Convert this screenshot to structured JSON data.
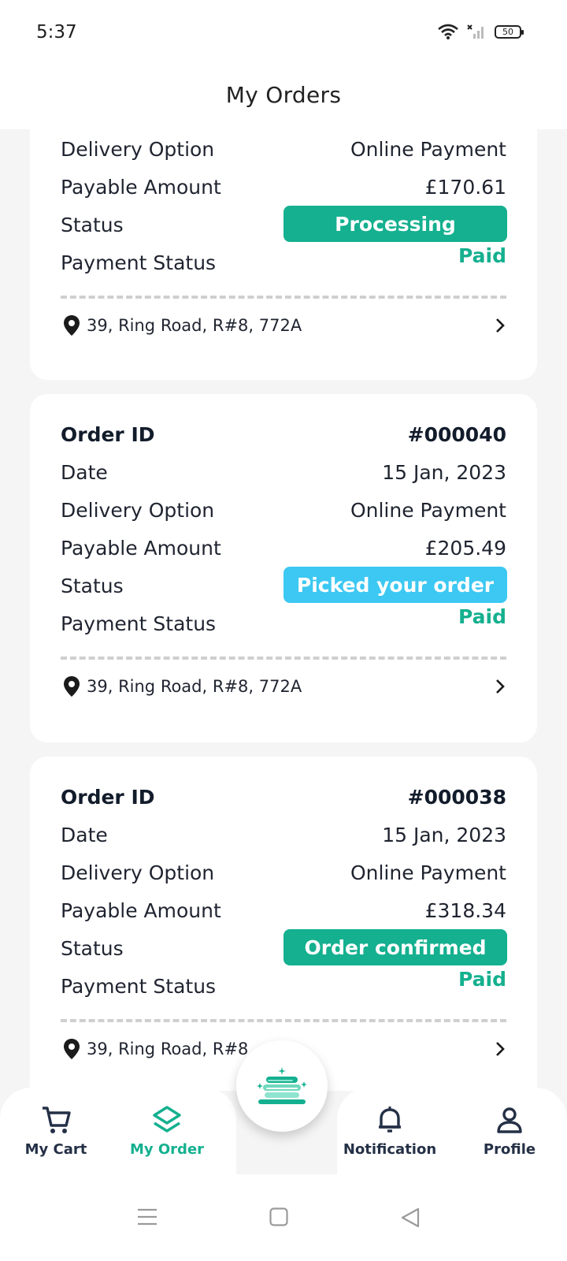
{
  "status_bar": {
    "time": "5:37",
    "battery": "50"
  },
  "header": {
    "title": "My Orders"
  },
  "labels": {
    "order_id": "Order ID",
    "date": "Date",
    "delivery_option": "Delivery Option",
    "payable_amount": "Payable Amount",
    "status": "Status",
    "payment_status": "Payment Status"
  },
  "orders": [
    {
      "delivery_option": "Online Payment",
      "payable_amount": "£170.61",
      "status": "Processing",
      "status_color": "#14b08f",
      "payment_status": "Paid",
      "address": "39, Ring Road, R#8, 772A"
    },
    {
      "order_id": "#000040",
      "date": "15 Jan, 2023",
      "delivery_option": "Online Payment",
      "payable_amount": "£205.49",
      "status": "Picked your order",
      "status_color": "#3cc8f2",
      "payment_status": "Paid",
      "address": "39, Ring Road, R#8, 772A"
    },
    {
      "order_id": "#000038",
      "date": "15 Jan, 2023",
      "delivery_option": "Online Payment",
      "payable_amount": "£318.34",
      "status": "Order confirmed",
      "status_color": "#14b08f",
      "payment_status": "Paid",
      "address": "39, Ring Road, R#8"
    }
  ],
  "bottom_nav": {
    "items": [
      {
        "label": "My Cart",
        "icon": "cart-icon",
        "active": false
      },
      {
        "label": "My Order",
        "icon": "layers-icon",
        "active": true
      },
      {
        "label": "Notification",
        "icon": "bell-icon",
        "active": false
      },
      {
        "label": "Profile",
        "icon": "user-icon",
        "active": false
      }
    ],
    "fab_icon": "laundry-stack-icon"
  },
  "system_nav": {
    "icons": [
      "menu-icon",
      "home-square-icon",
      "back-triangle-icon"
    ]
  },
  "colors": {
    "accent": "#14b08f",
    "info": "#3cc8f2",
    "text_dark": "#121c2b"
  }
}
